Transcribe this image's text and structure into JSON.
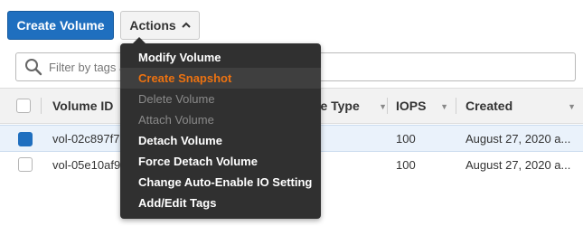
{
  "toolbar": {
    "create_label": "Create Volume",
    "actions_label": "Actions"
  },
  "filter": {
    "placeholder": "Filter by tags a"
  },
  "table": {
    "columns": [
      {
        "label": "Volume ID"
      },
      {
        "label": "me Type"
      },
      {
        "label": "IOPS"
      },
      {
        "label": "Created"
      }
    ],
    "rows": [
      {
        "volume_id": "vol-02c897f7",
        "iops": "100",
        "created": "August 27, 2020 a...",
        "selected": true
      },
      {
        "volume_id": "vol-05e10af9",
        "iops": "100",
        "created": "August 27, 2020 a...",
        "selected": false
      }
    ]
  },
  "menu": {
    "items": [
      {
        "label": "Modify Volume",
        "state": "enabled"
      },
      {
        "label": "Create Snapshot",
        "state": "hover"
      },
      {
        "label": "Delete Volume",
        "state": "disabled"
      },
      {
        "label": "Attach Volume",
        "state": "disabled"
      },
      {
        "label": "Detach Volume",
        "state": "enabled"
      },
      {
        "label": "Force Detach Volume",
        "state": "enabled"
      },
      {
        "label": "Change Auto-Enable IO Setting",
        "state": "enabled"
      },
      {
        "label": "Add/Edit Tags",
        "state": "enabled"
      }
    ]
  },
  "colors": {
    "primary": "#1f6fbf",
    "menu_bg": "#303030",
    "menu_hover_text": "#ec7211",
    "menu_disabled_text": "#8a8a8a"
  }
}
